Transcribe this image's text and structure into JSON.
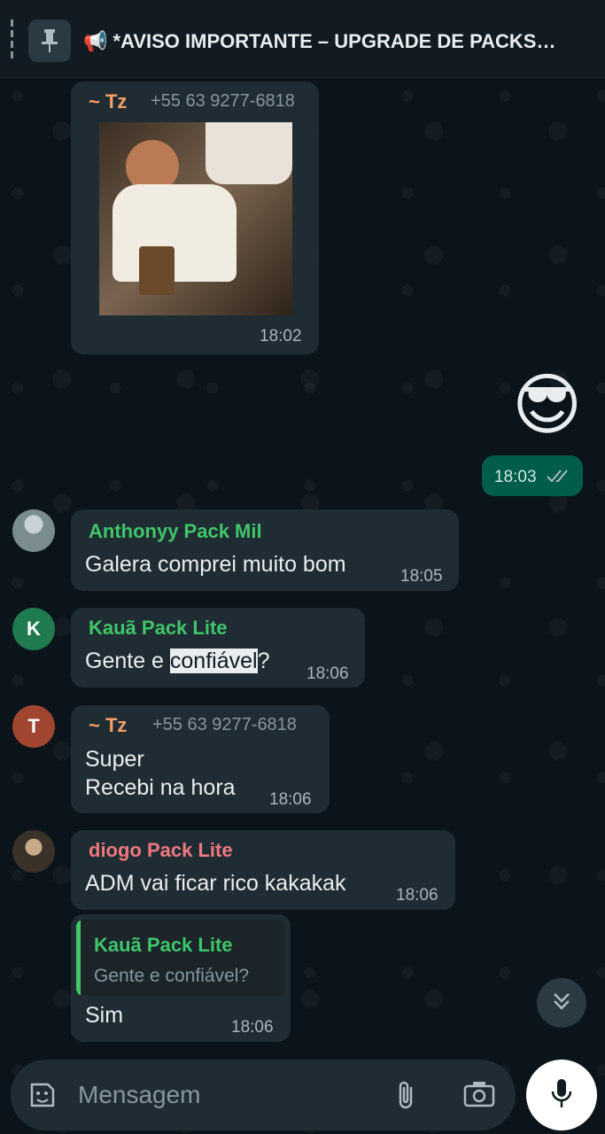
{
  "pinned": {
    "text": "📢 *AVISO IMPORTANTE – UPGRADE DE PACKS…"
  },
  "messages": {
    "m1": {
      "sender": "~ Tz",
      "phone": "+55 63 9277-6818",
      "time": "18:02",
      "sender_color": "#f5a06a"
    },
    "m2": {
      "emoji": "😎",
      "time": "18:03",
      "status_icon": "double-check"
    },
    "m3": {
      "sender": "Anthonyy Pack Mil",
      "text": "Galera comprei muito bom",
      "time": "18:05",
      "sender_color": "#53bdeb"
    },
    "m4": {
      "sender": "Kauã Pack Lite",
      "text_before": "Gente e ",
      "text_highlight": "confiável",
      "text_after": "?",
      "time": "18:06",
      "avatar_letter": "K",
      "avatar_color": "#1f7a4f"
    },
    "m5": {
      "sender": "~ Tz",
      "phone": "+55 63 9277-6818",
      "line1": "Super",
      "line2": "Recebi na hora",
      "time": "18:06",
      "avatar_letter": "T",
      "avatar_color": "#a0452f"
    },
    "m6": {
      "sender": "diogo Pack Lite",
      "text": "ADM vai ficar rico kakakak",
      "time": "18:06",
      "sender_color": "#f0787f"
    },
    "m7": {
      "quote_sender": "Kauã Pack Lite",
      "quote_text": "Gente e confiável?",
      "text": "Sim",
      "time": "18:06"
    }
  },
  "input": {
    "placeholder": "Mensagem"
  },
  "colors": {
    "green_name": "#3fc56a",
    "accent": "#00a884"
  }
}
